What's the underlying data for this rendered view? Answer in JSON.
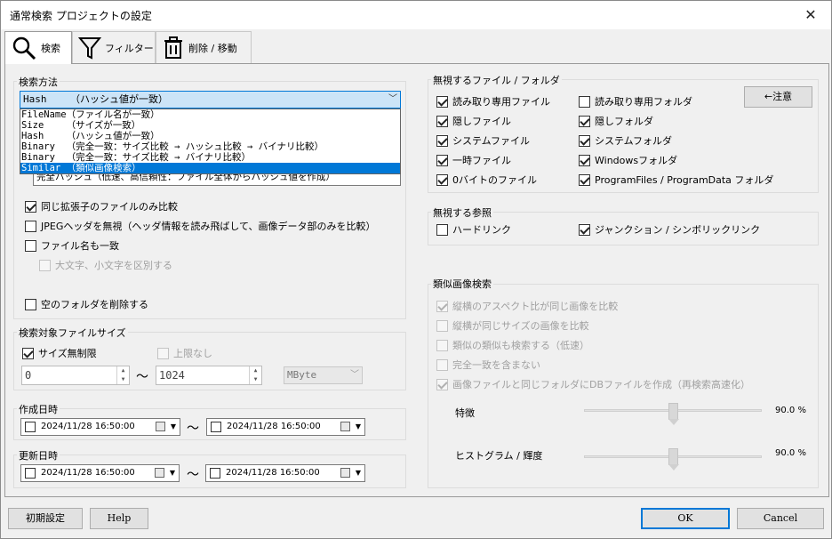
{
  "window": {
    "title": "通常検索 プロジェクトの設定",
    "close": "✕"
  },
  "tabs": [
    {
      "label": "検索",
      "icon": "magnifier-icon"
    },
    {
      "label": "フィルター",
      "icon": "filter-funnel-icon"
    },
    {
      "label": "削除 / 移動",
      "icon": "trash-icon"
    }
  ],
  "search_method": {
    "label": "検索方法",
    "selected": "Hash    （ハッシュ値が一致）",
    "options": [
      "FileName（ファイル名が一致）",
      "Size    （サイズが一致）",
      "Hash    （ハッシュ値が一致）",
      "Binary  （完全一致：サイズ比較 → ハッシュ比較 → バイナリ比較）",
      "Binary  （完全一致：サイズ比較 → バイナリ比較）",
      "Similar （類似画像検索）"
    ],
    "highlighted_index": 5,
    "hash_combo": "完全ハッシュ（低速、高信頼性：ファイル全体からハッシュ値を作成）",
    "checks": [
      {
        "label": "同じ拡張子のファイルのみ比較",
        "checked": true,
        "disabled": false
      },
      {
        "label": "JPEGヘッダを無視（ヘッダ情報を読み飛ばして、画像データ部のみを比較）",
        "checked": false,
        "disabled": false
      },
      {
        "label": "ファイル名も一致",
        "checked": false,
        "disabled": false
      },
      {
        "label": "大文字、小文字を区別する",
        "checked": false,
        "disabled": true
      },
      {
        "label": "空のフォルダを削除する",
        "checked": false,
        "disabled": false
      }
    ]
  },
  "file_size": {
    "label": "検索対象ファイルサイズ",
    "unlimited": {
      "label": "サイズ無制限",
      "checked": true
    },
    "no_upper": {
      "label": "上限なし",
      "checked": false
    },
    "min": "0",
    "tilde": "～",
    "max": "1024",
    "unit": "MByte"
  },
  "created": {
    "label": "作成日時",
    "from": "2024/11/28 16:50:00",
    "to": "2024/11/28 16:50:00",
    "tilde": "～"
  },
  "modified": {
    "label": "更新日時",
    "from": "2024/11/28 16:50:00",
    "to": "2024/11/28 16:50:00",
    "tilde": "～"
  },
  "ignore_files": {
    "label": "無視するファイル / フォルダ",
    "caution_button": "←注意",
    "left": [
      {
        "label": "読み取り専用ファイル",
        "checked": true
      },
      {
        "label": "隠しファイル",
        "checked": true
      },
      {
        "label": "システムファイル",
        "checked": true
      },
      {
        "label": "一時ファイル",
        "checked": true
      },
      {
        "label": "0バイトのファイル",
        "checked": true
      }
    ],
    "right": [
      {
        "label": "読み取り専用フォルダ",
        "checked": false
      },
      {
        "label": "隠しフォルダ",
        "checked": true
      },
      {
        "label": "システムフォルダ",
        "checked": true
      },
      {
        "label": "Windowsフォルダ",
        "checked": true
      },
      {
        "label": "ProgramFiles / ProgramData フォルダ",
        "checked": true
      }
    ]
  },
  "ignore_refs": {
    "label": "無視する参照",
    "hardlink": {
      "label": "ハードリンク",
      "checked": false
    },
    "junction": {
      "label": "ジャンクション / シンボリックリンク",
      "checked": true
    }
  },
  "similar": {
    "label": "類似画像検索",
    "checks": [
      {
        "label": "縦横のアスペクト比が同じ画像を比較",
        "checked": true
      },
      {
        "label": "縦横が同じサイズの画像を比較",
        "checked": false
      },
      {
        "label": "類似の類似も検索する（低速）",
        "checked": false
      },
      {
        "label": "完全一致を含まない",
        "checked": false
      },
      {
        "label": "画像ファイルと同じフォルダにDBファイルを作成（再検索高速化）",
        "checked": true
      }
    ],
    "feature": {
      "label": "特徴",
      "value": "90.0 %",
      "level": 0.5
    },
    "histogram": {
      "label": "ヒストグラム / 輝度",
      "value": "90.0 %",
      "level": 0.5
    }
  },
  "footer": {
    "reset": "初期設定",
    "help": "Help",
    "ok": "OK",
    "cancel": "Cancel"
  }
}
